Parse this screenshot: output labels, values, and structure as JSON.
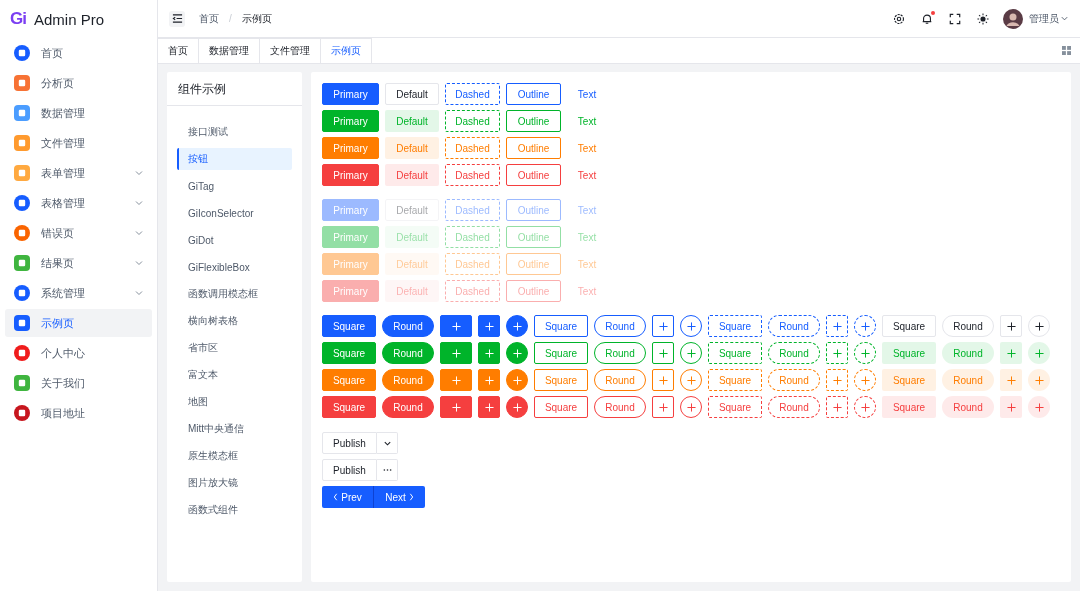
{
  "brand": {
    "logo": "Gi",
    "name": "Admin Pro"
  },
  "sidebar": {
    "items": [
      {
        "label": "首页",
        "color": "#165dff",
        "kind": "circle",
        "has_children": false,
        "selected": false
      },
      {
        "label": "分析页",
        "color": "#f77234",
        "kind": "square",
        "has_children": false,
        "selected": false
      },
      {
        "label": "数据管理",
        "color": "#4b9dff",
        "kind": "square",
        "has_children": false,
        "selected": false
      },
      {
        "label": "文件管理",
        "color": "#ff9a2e",
        "kind": "square",
        "has_children": false,
        "selected": false
      },
      {
        "label": "表单管理",
        "color": "#ffa940",
        "kind": "square",
        "has_children": true,
        "selected": false
      },
      {
        "label": "表格管理",
        "color": "#165dff",
        "kind": "circle",
        "has_children": true,
        "selected": false
      },
      {
        "label": "错误页",
        "color": "#fa6400",
        "kind": "circle",
        "has_children": true,
        "selected": false
      },
      {
        "label": "结果页",
        "color": "#3fb53f",
        "kind": "square",
        "has_children": true,
        "selected": false
      },
      {
        "label": "系统管理",
        "color": "#165dff",
        "kind": "circle",
        "has_children": true,
        "selected": false
      },
      {
        "label": "示例页",
        "color": "#165dff",
        "kind": "square",
        "has_children": false,
        "selected": true
      },
      {
        "label": "个人中心",
        "color": "#f01c1c",
        "kind": "circle",
        "has_children": false,
        "selected": false
      },
      {
        "label": "关于我们",
        "color": "#3fb53f",
        "kind": "square",
        "has_children": false,
        "selected": false
      },
      {
        "label": "项目地址",
        "color": "#c7161e",
        "kind": "circle",
        "has_children": false,
        "selected": false
      }
    ]
  },
  "header": {
    "breadcrumb": [
      "首页",
      "示例页"
    ],
    "separator": "/",
    "notification": {
      "unread": true
    },
    "user": "管理员"
  },
  "tabs": [
    {
      "label": "首页",
      "selected": false
    },
    {
      "label": "数据管理",
      "selected": false
    },
    {
      "label": "文件管理",
      "selected": false
    },
    {
      "label": "示例页",
      "selected": true
    }
  ],
  "examples": {
    "title": "组件示例",
    "items": [
      {
        "label": "接口测试",
        "selected": false
      },
      {
        "label": "按钮",
        "selected": true
      },
      {
        "label": "GiTag",
        "selected": false
      },
      {
        "label": "GiIconSelector",
        "selected": false
      },
      {
        "label": "GiDot",
        "selected": false
      },
      {
        "label": "GiFlexibleBox",
        "selected": false
      },
      {
        "label": "函数调用模态框",
        "selected": false
      },
      {
        "label": "横向树表格",
        "selected": false
      },
      {
        "label": "省市区",
        "selected": false
      },
      {
        "label": "富文本",
        "selected": false
      },
      {
        "label": "地图",
        "selected": false
      },
      {
        "label": "Mitt中央通信",
        "selected": false
      },
      {
        "label": "原生模态框",
        "selected": false
      },
      {
        "label": "图片放大镜",
        "selected": false
      },
      {
        "label": "函数式组件",
        "selected": false
      }
    ]
  },
  "button_rows": [
    {
      "kind": "normal",
      "color": "#165dff",
      "disabled": false,
      "buttons": [
        {
          "kind": "primary",
          "label": "Primary"
        },
        {
          "kind": "default",
          "label": "Default"
        },
        {
          "kind": "dashed",
          "label": "Dashed"
        },
        {
          "kind": "outline",
          "label": "Outline"
        },
        {
          "kind": "text",
          "label": "Text"
        }
      ]
    },
    {
      "kind": "success",
      "color": "#00b42a",
      "disabled": false,
      "buttons": [
        {
          "kind": "primary",
          "label": "Primary"
        },
        {
          "kind": "default",
          "label": "Default"
        },
        {
          "kind": "dashed",
          "label": "Dashed"
        },
        {
          "kind": "outline",
          "label": "Outline"
        },
        {
          "kind": "text",
          "label": "Text"
        }
      ]
    },
    {
      "kind": "warning",
      "color": "#ff7d00",
      "disabled": false,
      "buttons": [
        {
          "kind": "primary",
          "label": "Primary"
        },
        {
          "kind": "default",
          "label": "Default"
        },
        {
          "kind": "dashed",
          "label": "Dashed"
        },
        {
          "kind": "outline",
          "label": "Outline"
        },
        {
          "kind": "text",
          "label": "Text"
        }
      ]
    },
    {
      "kind": "danger",
      "color": "#f53f3f",
      "disabled": false,
      "buttons": [
        {
          "kind": "primary",
          "label": "Primary"
        },
        {
          "kind": "default",
          "label": "Default"
        },
        {
          "kind": "dashed",
          "label": "Dashed"
        },
        {
          "kind": "outline",
          "label": "Outline"
        },
        {
          "kind": "text",
          "label": "Text"
        }
      ]
    },
    {
      "kind": "normal",
      "disabled": true,
      "buttons": [
        {
          "kind": "primary",
          "label": "Primary"
        },
        {
          "kind": "default",
          "label": "Default"
        },
        {
          "kind": "dashed",
          "label": "Dashed"
        },
        {
          "kind": "outline",
          "label": "Outline"
        },
        {
          "kind": "text",
          "label": "Text"
        }
      ]
    },
    {
      "kind": "success",
      "disabled": true,
      "buttons": [
        {
          "kind": "primary",
          "label": "Primary"
        },
        {
          "kind": "default",
          "label": "Default"
        },
        {
          "kind": "dashed",
          "label": "Dashed"
        },
        {
          "kind": "outline",
          "label": "Outline"
        },
        {
          "kind": "text",
          "label": "Text"
        }
      ]
    },
    {
      "kind": "warning",
      "disabled": true,
      "buttons": [
        {
          "kind": "primary",
          "label": "Primary"
        },
        {
          "kind": "default",
          "label": "Default"
        },
        {
          "kind": "dashed",
          "label": "Dashed"
        },
        {
          "kind": "outline",
          "label": "Outline"
        },
        {
          "kind": "text",
          "label": "Text"
        }
      ]
    },
    {
      "kind": "danger",
      "disabled": true,
      "buttons": [
        {
          "kind": "primary",
          "label": "Primary"
        },
        {
          "kind": "default",
          "label": "Default"
        },
        {
          "kind": "dashed",
          "label": "Dashed"
        },
        {
          "kind": "outline",
          "label": "Outline"
        },
        {
          "kind": "text",
          "label": "Text"
        }
      ]
    }
  ],
  "shape_rows": [
    {
      "kind": "normal",
      "color": "#165dff",
      "groups": [
        {
          "kind": "primary",
          "buttons": [
            {
              "kind": "square",
              "label": "Square"
            },
            {
              "kind": "round",
              "label": "Round"
            },
            {
              "kind": "wide"
            },
            {
              "kind": "box"
            },
            {
              "kind": "circle"
            }
          ]
        },
        {
          "kind": "outline",
          "buttons": [
            {
              "kind": "square",
              "label": "Square"
            },
            {
              "kind": "round",
              "label": "Round"
            },
            {
              "kind": "box"
            },
            {
              "kind": "circle"
            }
          ]
        },
        {
          "kind": "dashed",
          "buttons": [
            {
              "kind": "square",
              "label": "Square"
            },
            {
              "kind": "round",
              "label": "Round"
            },
            {
              "kind": "box"
            },
            {
              "kind": "circle"
            }
          ]
        },
        {
          "kind": "default",
          "buttons": [
            {
              "kind": "square",
              "label": "Square"
            },
            {
              "kind": "round",
              "label": "Round"
            },
            {
              "kind": "box"
            },
            {
              "kind": "circle"
            }
          ]
        }
      ]
    },
    {
      "kind": "success",
      "color": "#00b42a",
      "groups": [
        {
          "kind": "primary",
          "buttons": [
            {
              "kind": "square",
              "label": "Square"
            },
            {
              "kind": "round",
              "label": "Round"
            },
            {
              "kind": "wide"
            },
            {
              "kind": "box"
            },
            {
              "kind": "circle"
            }
          ]
        },
        {
          "kind": "outline",
          "buttons": [
            {
              "kind": "square",
              "label": "Square"
            },
            {
              "kind": "round",
              "label": "Round"
            },
            {
              "kind": "box"
            },
            {
              "kind": "circle"
            }
          ]
        },
        {
          "kind": "dashed",
          "buttons": [
            {
              "kind": "square",
              "label": "Square"
            },
            {
              "kind": "round",
              "label": "Round"
            },
            {
              "kind": "box"
            },
            {
              "kind": "circle"
            }
          ]
        },
        {
          "kind": "default",
          "buttons": [
            {
              "kind": "square",
              "label": "Square"
            },
            {
              "kind": "round",
              "label": "Round"
            },
            {
              "kind": "box"
            },
            {
              "kind": "circle"
            }
          ]
        }
      ]
    },
    {
      "kind": "warning",
      "color": "#ff7d00",
      "groups": [
        {
          "kind": "primary",
          "buttons": [
            {
              "kind": "square",
              "label": "Square"
            },
            {
              "kind": "round",
              "label": "Round"
            },
            {
              "kind": "wide"
            },
            {
              "kind": "box"
            },
            {
              "kind": "circle"
            }
          ]
        },
        {
          "kind": "outline",
          "buttons": [
            {
              "kind": "square",
              "label": "Square"
            },
            {
              "kind": "round",
              "label": "Round"
            },
            {
              "kind": "box"
            },
            {
              "kind": "circle"
            }
          ]
        },
        {
          "kind": "dashed",
          "buttons": [
            {
              "kind": "square",
              "label": "Square"
            },
            {
              "kind": "round",
              "label": "Round"
            },
            {
              "kind": "box"
            },
            {
              "kind": "circle"
            }
          ]
        },
        {
          "kind": "default",
          "buttons": [
            {
              "kind": "square",
              "label": "Square"
            },
            {
              "kind": "round",
              "label": "Round"
            },
            {
              "kind": "box"
            },
            {
              "kind": "circle"
            }
          ]
        }
      ]
    },
    {
      "kind": "danger",
      "color": "#f53f3f",
      "groups": [
        {
          "kind": "primary",
          "buttons": [
            {
              "kind": "square",
              "label": "Square"
            },
            {
              "kind": "round",
              "label": "Round"
            },
            {
              "kind": "wide"
            },
            {
              "kind": "box"
            },
            {
              "kind": "circle"
            }
          ]
        },
        {
          "kind": "outline",
          "buttons": [
            {
              "kind": "square",
              "label": "Square"
            },
            {
              "kind": "round",
              "label": "Round"
            },
            {
              "kind": "box"
            },
            {
              "kind": "circle"
            }
          ]
        },
        {
          "kind": "dashed",
          "buttons": [
            {
              "kind": "square",
              "label": "Square"
            },
            {
              "kind": "round",
              "label": "Round"
            },
            {
              "kind": "box"
            },
            {
              "kind": "circle"
            }
          ]
        },
        {
          "kind": "default",
          "buttons": [
            {
              "kind": "square",
              "label": "Square"
            },
            {
              "kind": "round",
              "label": "Round"
            },
            {
              "kind": "box"
            },
            {
              "kind": "circle"
            }
          ]
        }
      ]
    }
  ],
  "button_groups": [
    {
      "label": "Publish",
      "kind": "dropdown"
    },
    {
      "label": "Publish",
      "kind": "more"
    }
  ],
  "pager": {
    "prev": "Prev",
    "next": "Next"
  }
}
